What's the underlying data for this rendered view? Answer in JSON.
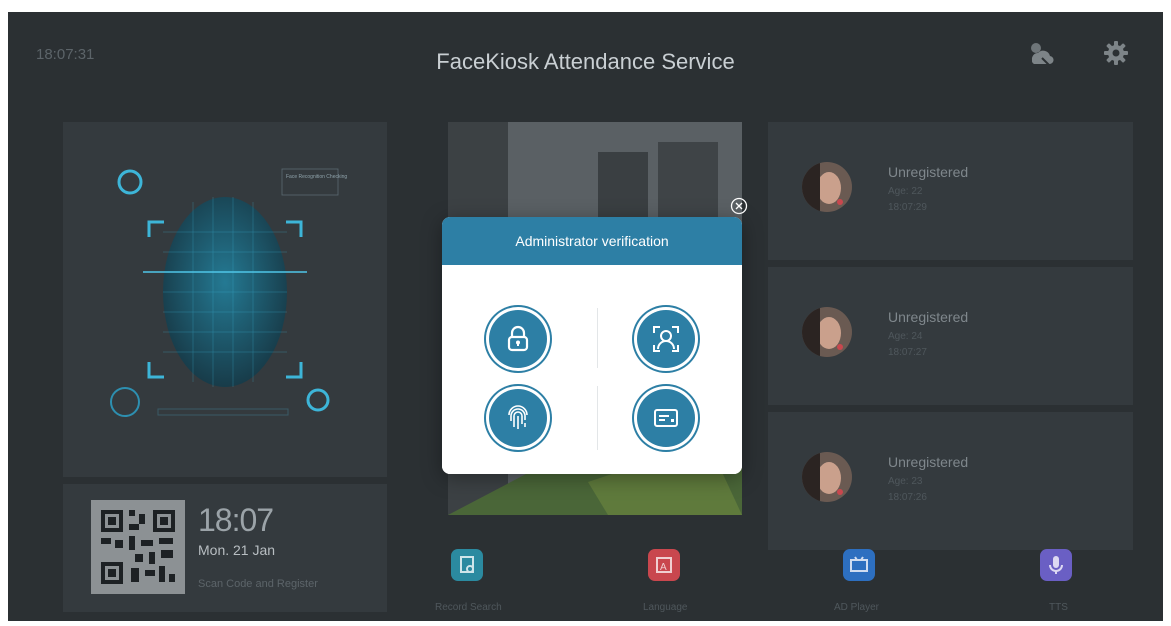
{
  "header": {
    "clock": "18:07:31",
    "title": "FaceKiosk Attendance Service",
    "icons": [
      "weather-icon",
      "settings-gear-icon"
    ]
  },
  "face_panel": {
    "tag_text": "Face Recognition Checking"
  },
  "records": [
    {
      "status": "Unregistered",
      "age": "Age: 22",
      "time": "18:07:29"
    },
    {
      "status": "Unregistered",
      "age": "Age: 24",
      "time": "18:07:27"
    },
    {
      "status": "Unregistered",
      "age": "Age: 23",
      "time": "18:07:26"
    }
  ],
  "info": {
    "time": "18:07",
    "date": "Mon. 21 Jan",
    "scan_text": "Scan Code and Register"
  },
  "bottom_buttons": [
    {
      "label": "Record Search",
      "color": "#2b8aa0"
    },
    {
      "label": "Language",
      "color": "#c9474e"
    },
    {
      "label": "AD Player",
      "color": "#2d6fc0"
    },
    {
      "label": "TTS",
      "color": "#6a5fc4"
    }
  ],
  "dialog": {
    "title": "Administrator verification",
    "options": [
      "password-lock-icon",
      "face-scan-icon",
      "fingerprint-icon",
      "card-icon"
    ],
    "accent": "#2d7fa5"
  }
}
